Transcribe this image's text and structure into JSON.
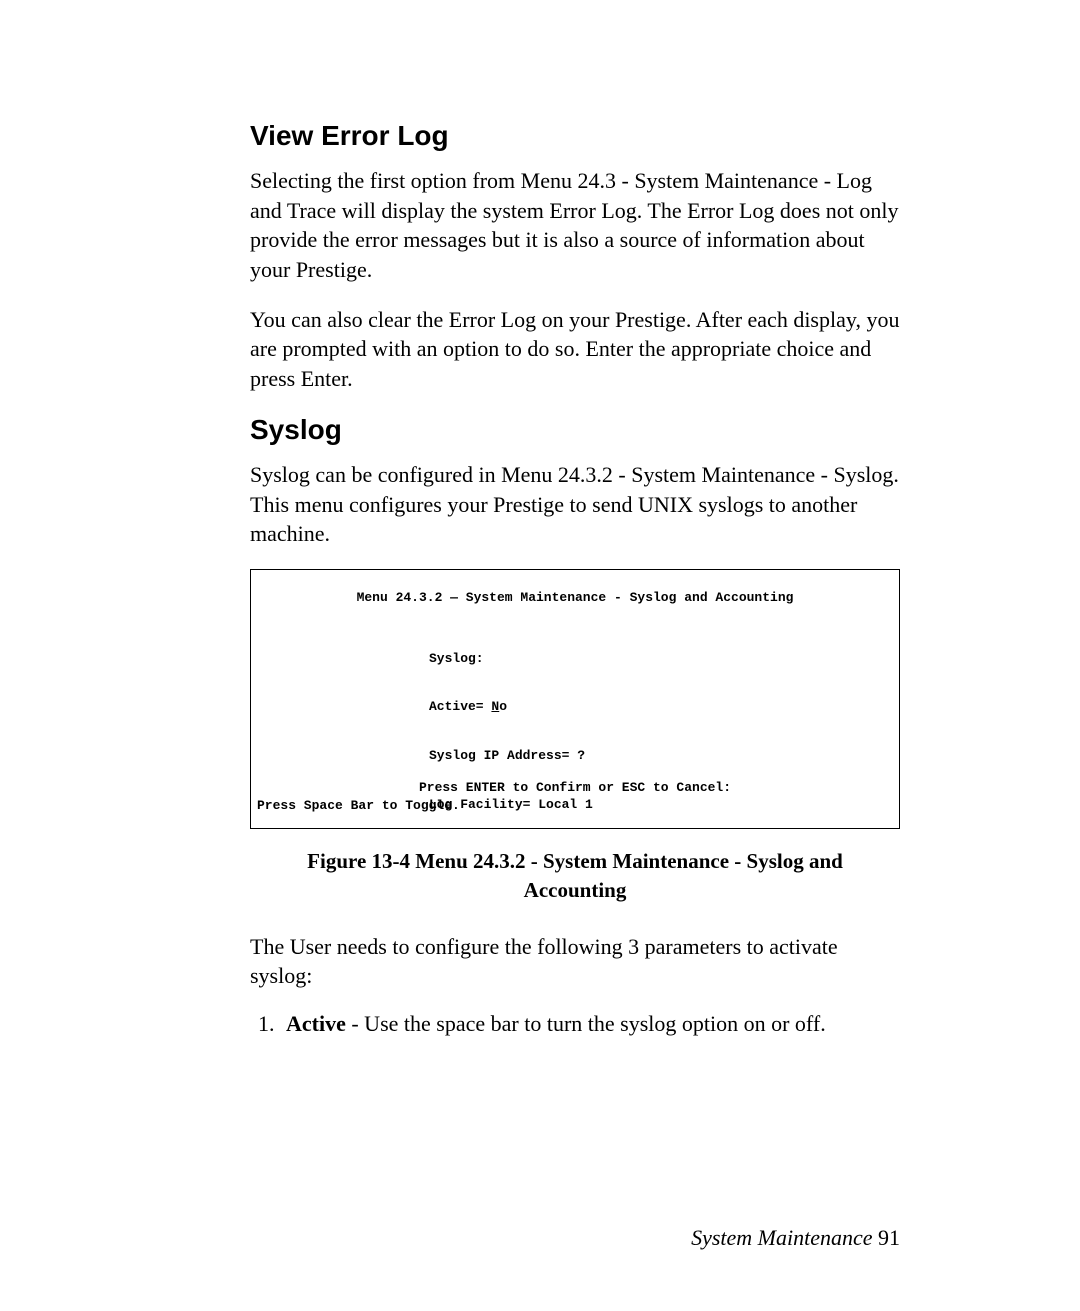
{
  "section1": {
    "heading": "View Error Log",
    "para1": "Selecting the first option from Menu 24.3 - System Maintenance - Log and Trace will display the system Error Log. The Error Log does not only provide the error messages but it is also a source of information about your Prestige.",
    "para2": "You can also clear the Error Log on your Prestige. After each display, you are prompted with an option to do so. Enter the appropriate choice and press Enter."
  },
  "section2": {
    "heading": "Syslog",
    "para1": "Syslog can be configured in Menu 24.3.2 - System Maintenance - Syslog. This menu configures your Prestige to send UNIX syslogs to another machine."
  },
  "terminal": {
    "title": "Menu 24.3.2 — System Maintenance - Syslog and Accounting",
    "line_syslog": "Syslog:",
    "line_active_label": "Active= ",
    "line_active_value_first": "N",
    "line_active_value_rest": "o",
    "line_ip": "Syslog IP Address= ?",
    "line_facility": "Log Facility= Local 1",
    "confirm": "Press ENTER to Confirm or ESC to Cancel:",
    "toggle": "Press Space Bar to Toggle."
  },
  "figure_caption": "Figure 13-4 Menu 24.3.2 - System Maintenance - Syslog and Accounting",
  "para_after_figure": "The User needs to configure the following 3 parameters to activate syslog:",
  "list": {
    "item1_num": "1.",
    "item1_bold": "Active",
    "item1_rest": " - Use the space bar to turn the syslog option on or off."
  },
  "footer": {
    "label": "System Maintenance  ",
    "page": "91"
  }
}
